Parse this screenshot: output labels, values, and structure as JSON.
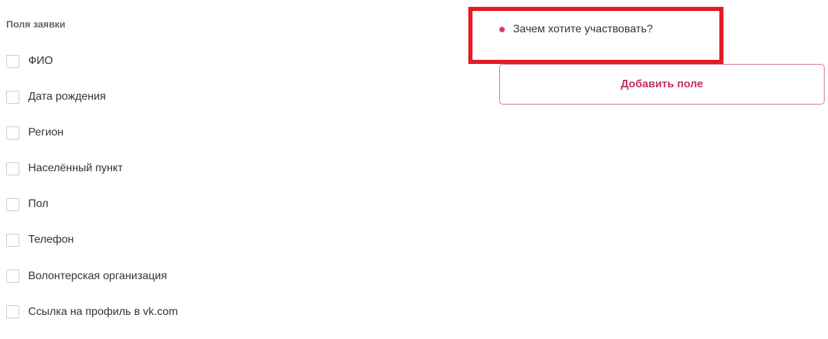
{
  "section_title": "Поля заявки",
  "fields": [
    {
      "label": "ФИО",
      "checked": false
    },
    {
      "label": "Дата рождения",
      "checked": false
    },
    {
      "label": "Регион",
      "checked": false
    },
    {
      "label": "Населённый пункт",
      "checked": false
    },
    {
      "label": "Пол",
      "checked": false
    },
    {
      "label": "Телефон",
      "checked": false
    },
    {
      "label": "Волонтерская организация",
      "checked": false
    },
    {
      "label": "Ссылка на профиль в vk.com",
      "checked": false
    }
  ],
  "custom_fields": [
    {
      "label": "Зачем хотите участвовать?"
    }
  ],
  "add_field_button": {
    "label": "Добавить поле"
  },
  "colors": {
    "accent": "#c72d6a",
    "bullet": "#d63f7c",
    "highlight": "#e31c25",
    "checkbox_border": "#c9c9c9"
  },
  "icons": {
    "checkbox": "checkbox-icon",
    "bullet": "bullet-icon"
  }
}
